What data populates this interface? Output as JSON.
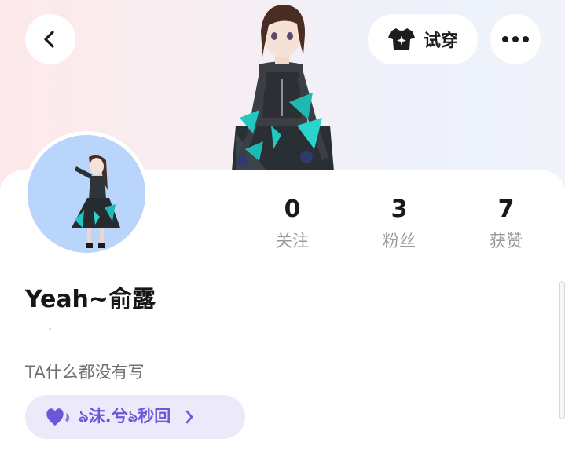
{
  "header": {
    "back_icon": "chevron-left-icon",
    "tryon_label": "试穿",
    "tryon_icon": "shirt-sparkle-icon",
    "more_icon": "ellipsis-icon"
  },
  "profile": {
    "username": "Yeah~俞露",
    "bio": "TA什么都没有写",
    "avatar_bg": "#b9d5fb"
  },
  "stats": [
    {
      "value": "0",
      "label": "关注"
    },
    {
      "value": "3",
      "label": "粉丝"
    },
    {
      "value": "7",
      "label": "获赞"
    }
  ],
  "tag": {
    "text": "ঌ沫.兮ঌ秒回",
    "icon": "hearts-icon",
    "color": "#6f55d8"
  }
}
